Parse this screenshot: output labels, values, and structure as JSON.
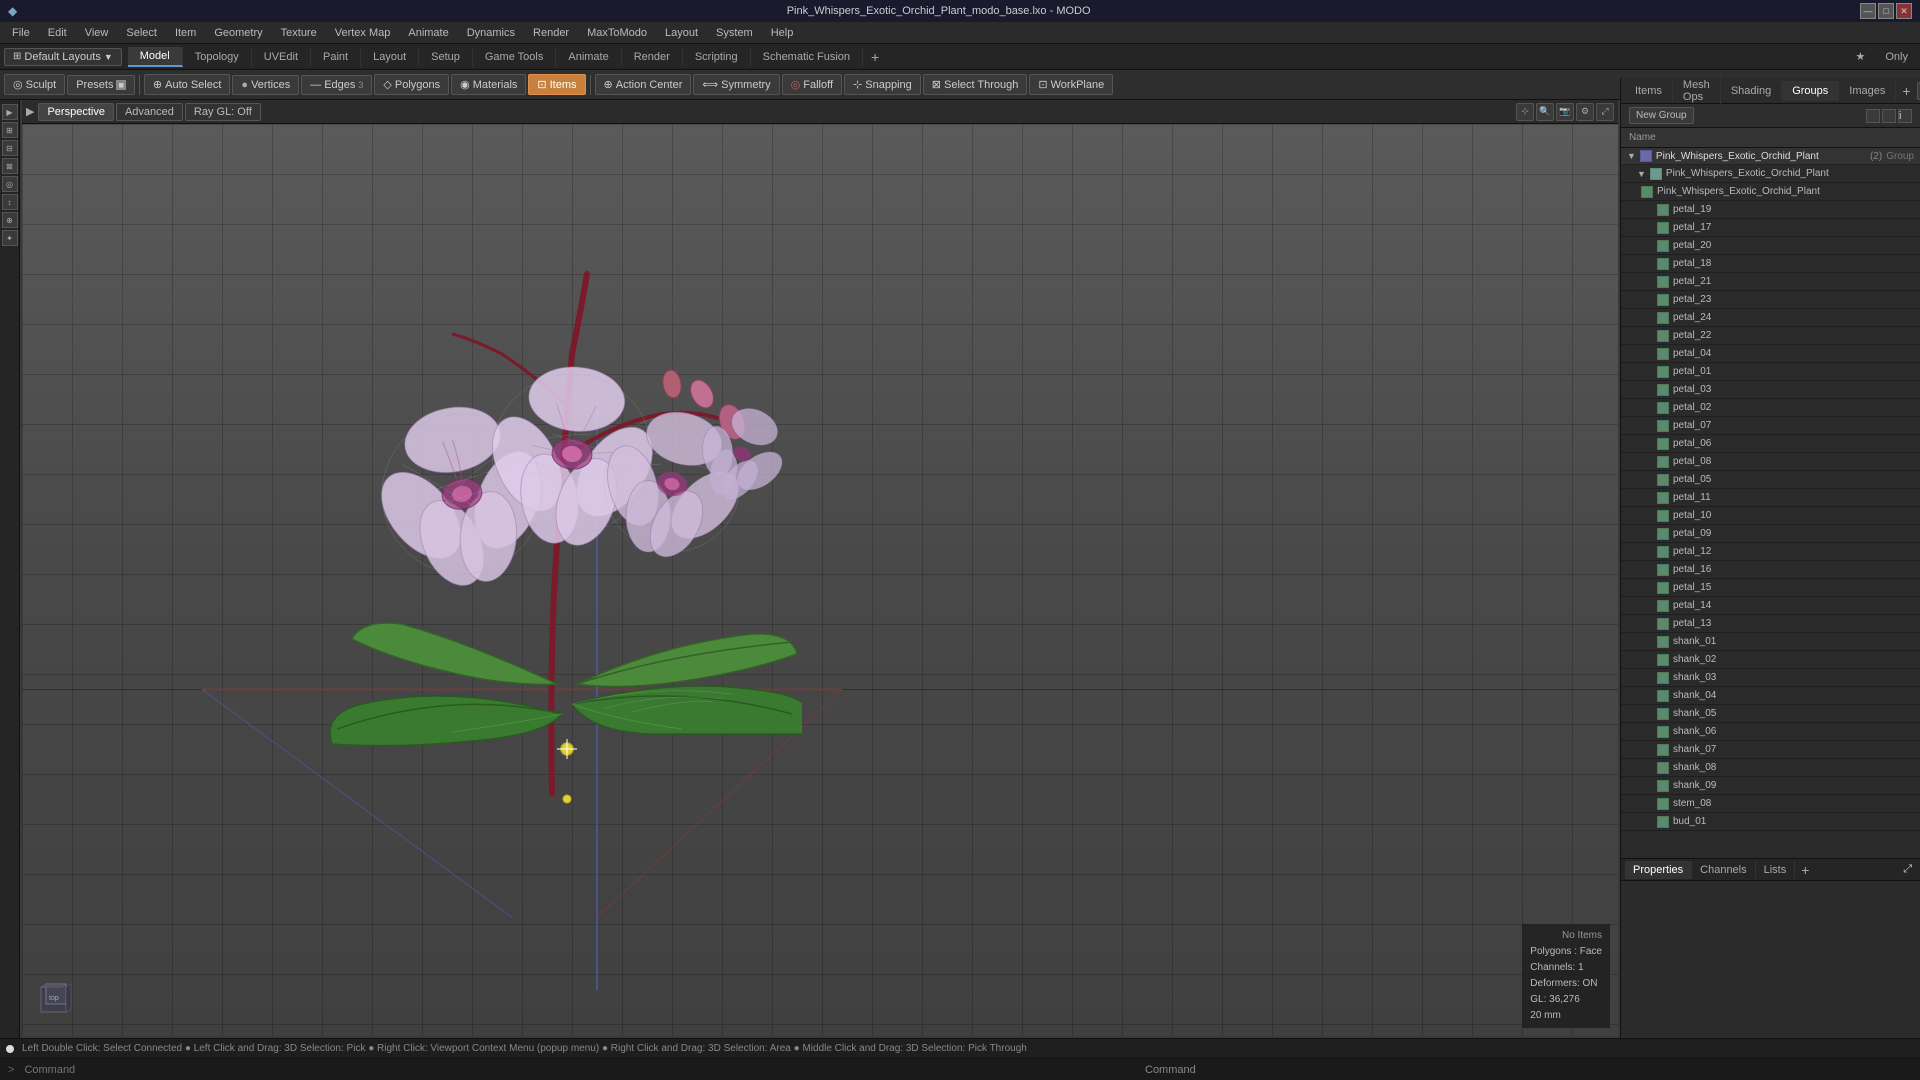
{
  "window": {
    "title": "Pink_Whispers_Exotic_Orchid_Plant_modo_base.lxo - MODO"
  },
  "titlebar": {
    "controls": [
      "—",
      "□",
      "✕"
    ]
  },
  "menubar": {
    "items": [
      "File",
      "Edit",
      "View",
      "Select",
      "Item",
      "Geometry",
      "Texture",
      "Vertex Map",
      "Animate",
      "Dynamics",
      "Render",
      "MaxToModo",
      "Layout",
      "System",
      "Help"
    ]
  },
  "layouts": {
    "label": "Default Layouts",
    "dropdown_icon": "▼"
  },
  "modetabs": {
    "items": [
      {
        "label": "Model",
        "active": true
      },
      {
        "label": "Topology",
        "active": false
      },
      {
        "label": "UVEdit",
        "active": false
      },
      {
        "label": "Paint",
        "active": false
      },
      {
        "label": "Layout",
        "active": false
      },
      {
        "label": "Setup",
        "active": false
      },
      {
        "label": "Game Tools",
        "active": false
      },
      {
        "label": "Animate",
        "active": false
      },
      {
        "label": "Render",
        "active": false
      },
      {
        "label": "Scripting",
        "active": false
      },
      {
        "label": "Schematic Fusion",
        "active": false
      }
    ],
    "right_items": [
      {
        "label": "★ Only"
      }
    ],
    "add_icon": "+"
  },
  "toolbar": {
    "sculpt_label": "Sculpt",
    "presets_label": "Presets",
    "autoselect_label": "Auto Select",
    "vertices_label": "Vertices",
    "edges_label": "Edges",
    "polygons_label": "Polygons",
    "materials_label": "Materials",
    "items_label": "Items",
    "action_center_label": "Action Center",
    "symmetry_label": "Symmetry",
    "falloff_label": "Falloff",
    "snapping_label": "Snapping",
    "select_through_label": "Select Through",
    "workplane_label": "WorkPlane"
  },
  "viewport": {
    "view_label": "Perspective",
    "advanced_label": "Advanced",
    "raygl_label": "Ray GL: Off"
  },
  "right_panel": {
    "tabs": [
      "Items",
      "Mesh Ops",
      "Shading",
      "Groups",
      "Images"
    ],
    "active_tab": "Groups",
    "new_group_btn": "New Group",
    "col_name": "Name",
    "root_item": {
      "label": "Pink_Whispers_Exotic_Orchid_Plant",
      "badge": "(2)",
      "type": "Group"
    },
    "items": [
      {
        "label": "Pink_Whispers_Exotic_Orchid_Plant",
        "depth": 1
      },
      {
        "label": "petal_19",
        "depth": 2
      },
      {
        "label": "petal_17",
        "depth": 2
      },
      {
        "label": "petal_20",
        "depth": 2
      },
      {
        "label": "petal_18",
        "depth": 2
      },
      {
        "label": "petal_21",
        "depth": 2
      },
      {
        "label": "petal_23",
        "depth": 2
      },
      {
        "label": "petal_24",
        "depth": 2
      },
      {
        "label": "petal_22",
        "depth": 2
      },
      {
        "label": "petal_04",
        "depth": 2
      },
      {
        "label": "petal_01",
        "depth": 2
      },
      {
        "label": "petal_03",
        "depth": 2
      },
      {
        "label": "petal_02",
        "depth": 2
      },
      {
        "label": "petal_07",
        "depth": 2
      },
      {
        "label": "petal_06",
        "depth": 2
      },
      {
        "label": "petal_08",
        "depth": 2
      },
      {
        "label": "petal_05",
        "depth": 2
      },
      {
        "label": "petal_11",
        "depth": 2
      },
      {
        "label": "petal_10",
        "depth": 2
      },
      {
        "label": "petal_09",
        "depth": 2
      },
      {
        "label": "petal_12",
        "depth": 2
      },
      {
        "label": "petal_16",
        "depth": 2
      },
      {
        "label": "petal_15",
        "depth": 2
      },
      {
        "label": "petal_14",
        "depth": 2
      },
      {
        "label": "petal_13",
        "depth": 2
      },
      {
        "label": "shank_01",
        "depth": 2
      },
      {
        "label": "shank_02",
        "depth": 2
      },
      {
        "label": "shank_03",
        "depth": 2
      },
      {
        "label": "shank_04",
        "depth": 2
      },
      {
        "label": "shank_05",
        "depth": 2
      },
      {
        "label": "shank_06",
        "depth": 2
      },
      {
        "label": "shank_07",
        "depth": 2
      },
      {
        "label": "shank_08",
        "depth": 2
      },
      {
        "label": "shank_09",
        "depth": 2
      },
      {
        "label": "stem_08",
        "depth": 2
      },
      {
        "label": "bud_01",
        "depth": 2
      }
    ]
  },
  "props_panel": {
    "tabs": [
      "Properties",
      "Channels",
      "Lists"
    ],
    "active_tab": "Properties"
  },
  "viewport_info": {
    "no_items": "No Items",
    "polygons_label": "Polygons : Face",
    "channels_label": "Channels: 1",
    "deformers_label": "Deformers: ON",
    "gl_label": "GL: 36,276",
    "size_label": "20 mm"
  },
  "statusbar": {
    "text": "Left Double Click: Select Connected  ●  Left Click and Drag: 3D Selection: Pick  ●  Right Click: Viewport Context Menu (popup menu)  ●  Right Click and Drag: 3D Selection: Area  ●  Middle Click and Drag: 3D Selection: Pick Through"
  },
  "commandbar": {
    "prompt": ">",
    "placeholder": "Command"
  },
  "colors": {
    "active_tab": "#c8813c",
    "accent_blue": "#5b9bd5",
    "bg_dark": "#252525",
    "bg_mid": "#2e2e2e",
    "bg_light": "#3a3a3a"
  }
}
